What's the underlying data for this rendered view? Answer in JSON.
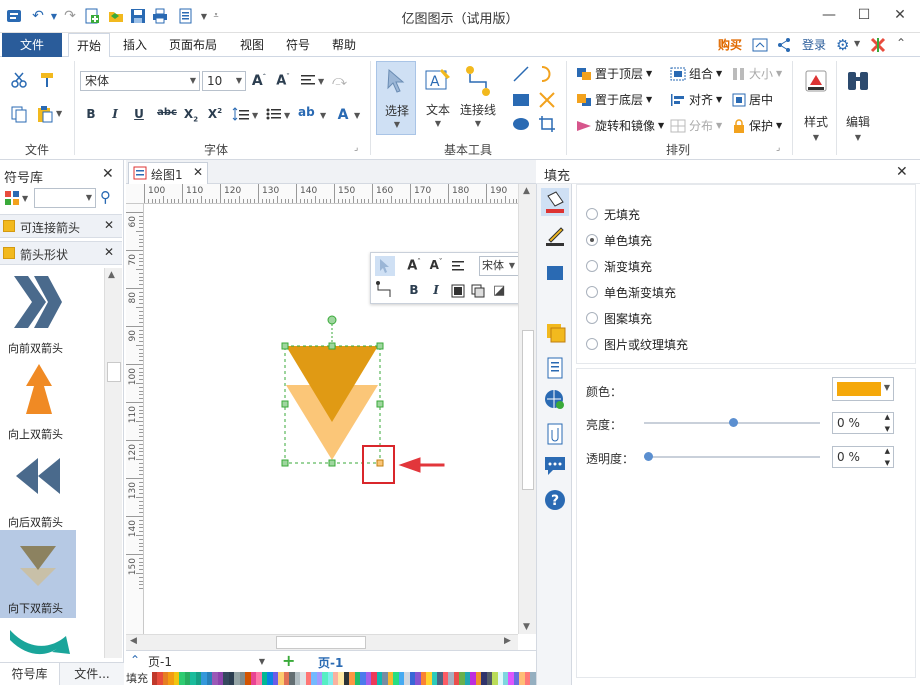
{
  "app": {
    "title": "亿图图示（试用版）"
  },
  "menu": {
    "file": "文件",
    "tabs": [
      "开始",
      "插入",
      "页面布局",
      "视图",
      "符号",
      "帮助"
    ],
    "buy": "购买",
    "login": "登录"
  },
  "ribbon": {
    "groups": {
      "file": "文件",
      "font": "字体",
      "basic_tools": "基本工具",
      "arrange": "排列"
    },
    "font_name": "宋体",
    "font_size": "10",
    "tools": {
      "select": "选择",
      "text": "文本",
      "connector": "连接线"
    },
    "arrange": {
      "bring_front": "置于顶层",
      "send_back": "置于底层",
      "rotate_mirror": "旋转和镜像",
      "group": "组合",
      "align": "对齐",
      "distribute": "分布",
      "size": "大小",
      "center": "居中",
      "protect": "保护"
    },
    "style": "样式",
    "edit": "编辑"
  },
  "left_panel": {
    "title": "符号库",
    "libraries": [
      "可连接箭头",
      "箭头形状"
    ],
    "shapes": [
      {
        "label": "向前双箭头"
      },
      {
        "label": "向上双箭头"
      },
      {
        "label": "向后双箭头"
      },
      {
        "label": "向下双箭头"
      }
    ],
    "bottom_tabs": [
      "符号库",
      "文件..."
    ]
  },
  "document": {
    "tab": "绘图1",
    "hruler_ticks": [
      "100",
      "110",
      "120",
      "130",
      "140",
      "150",
      "160",
      "170",
      "180",
      "190"
    ],
    "vruler_ticks": [
      "60",
      "70",
      "80",
      "90",
      "100",
      "110",
      "120",
      "130",
      "140",
      "150"
    ],
    "page_combo": "页-1",
    "page_tab": "页-1",
    "fill_label": "填充",
    "minitoolbar_font": "宋体"
  },
  "fill_panel": {
    "title": "填充",
    "options": [
      "无填充",
      "单色填充",
      "渐变填充",
      "单色渐变填充",
      "图案填充",
      "图片或纹理填充"
    ],
    "selected_index": 1,
    "color_label": "颜色：",
    "brightness_label": "亮度：",
    "transparency_label": "透明度：",
    "brightness_value": "0 %",
    "transparency_value": "0 %",
    "color": "#f5a80a"
  },
  "colors": {
    "accent": "#2a5c9a",
    "shape_front": "#e09a14",
    "shape_back": "#fbc678",
    "highlight_box": "#d9262b",
    "arrow": "#e2363b",
    "teal_shape": "#1aa59a",
    "slate_arrow": "#4a6a8c",
    "orange_arrow": "#f08a24"
  }
}
